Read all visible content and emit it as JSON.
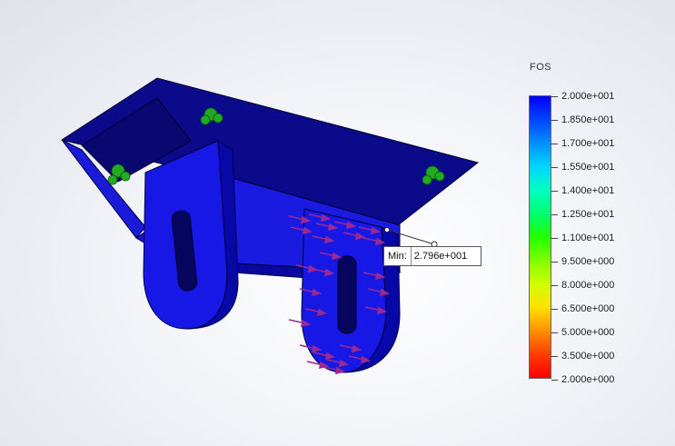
{
  "legend": {
    "title": "FOS",
    "colors": [
      "#0000ff",
      "#0044ff",
      "#0090ff",
      "#00d6ff",
      "#00ffc0",
      "#00ff70",
      "#20ff00",
      "#80ff00",
      "#d0ff00",
      "#ffe000",
      "#ff9000",
      "#ff3c00",
      "#ff0000"
    ],
    "labels": [
      "2.000e+001",
      "1.850e+001",
      "1.700e+001",
      "1.550e+001",
      "1.400e+001",
      "1.250e+001",
      "1.100e+001",
      "9.500e+000",
      "8.000e+000",
      "6.500e+000",
      "5.000e+000",
      "3.500e+000",
      "2.000e+000"
    ]
  },
  "probe": {
    "label": "Min:",
    "value": "2.796e+001"
  },
  "model": {
    "part_color": "#1010c8",
    "dark_color": "#08087a",
    "fixture_color": "#22aa22",
    "load_color": "#a0309a"
  }
}
